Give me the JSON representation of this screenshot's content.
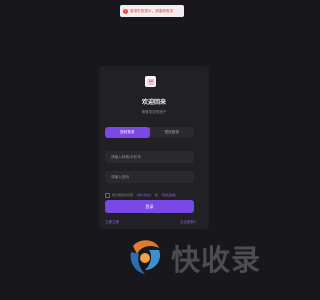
{
  "toast": {
    "message": "登录失败提示，请重新登录"
  },
  "card": {
    "title": "欢迎回来",
    "subtitle": "请登录您的账户"
  },
  "tabs": [
    {
      "label": "密码登录",
      "active": true
    },
    {
      "label": "短信登录",
      "active": false
    }
  ],
  "form": {
    "username_placeholder": "请输入邮箱/手机号",
    "password_placeholder": "请输入密码",
    "agree_prefix": "我已阅读并同意",
    "terms_link": "《用户协议》",
    "agree_and": "和",
    "privacy_link": "《隐私政策》",
    "submit_label": "登录"
  },
  "links": {
    "register": "立即注册",
    "forgot": "忘记密码?"
  },
  "watermark": {
    "text": "快收录"
  },
  "colors": {
    "background": "#18171c",
    "card": "#212025",
    "accent": "#7b48e8",
    "error": "#e0443b"
  },
  "icons": {
    "toast": "error-circle-icon",
    "logo": "app-logo-icon"
  }
}
